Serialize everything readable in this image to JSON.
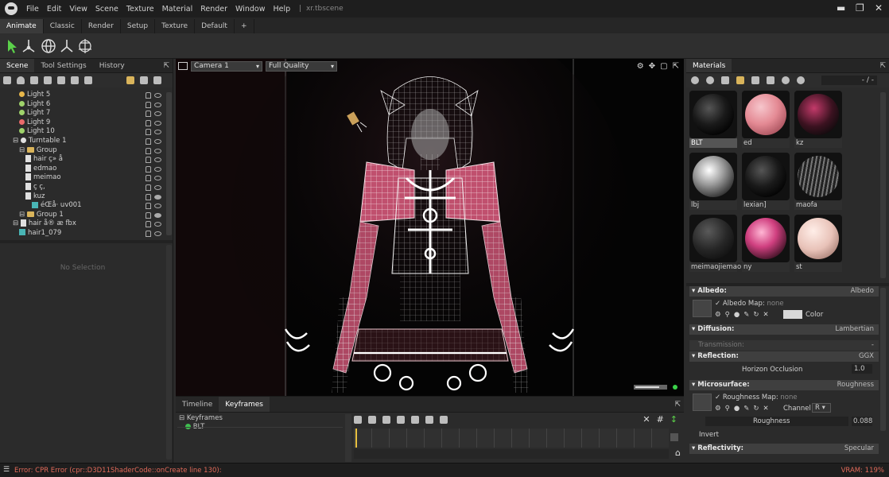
{
  "menubar": {
    "items": [
      "File",
      "Edit",
      "View",
      "Scene",
      "Texture",
      "Material",
      "Render",
      "Window",
      "Help"
    ],
    "filename": "xr.tbscene"
  },
  "modes": [
    "Animate",
    "Classic",
    "Render",
    "Setup",
    "Texture",
    "Default",
    "+"
  ],
  "left_tabs": [
    "Scene",
    "Tool Settings",
    "History"
  ],
  "tree": [
    {
      "indent": 2,
      "icon": "light",
      "color": "#e8b74a",
      "label": "Light 5"
    },
    {
      "indent": 2,
      "icon": "light",
      "color": "#9fd36b",
      "label": "Light 6"
    },
    {
      "indent": 2,
      "icon": "light",
      "color": "#9fd36b",
      "label": "Light 7"
    },
    {
      "indent": 2,
      "icon": "light",
      "color": "#e96a6a",
      "label": "Light 9"
    },
    {
      "indent": 2,
      "icon": "light",
      "color": "#9fd36b",
      "label": "Light 10"
    },
    {
      "indent": 1,
      "icon": "turntable",
      "color": "#e0e0e0",
      "label": "Turntable 1"
    },
    {
      "indent": 2,
      "icon": "folder",
      "label": "Group"
    },
    {
      "indent": 3,
      "icon": "doc",
      "label": "hair ç» å"
    },
    {
      "indent": 3,
      "icon": "doc",
      "label": "edmao"
    },
    {
      "indent": 3,
      "icon": "doc",
      "label": "meimao"
    },
    {
      "indent": 3,
      "icon": "doc",
      "label": "ç    ç,"
    },
    {
      "indent": 3,
      "icon": "doc",
      "label": "kuz"
    },
    {
      "indent": 4,
      "icon": "cube",
      "label": "éŒå·    uv001"
    },
    {
      "indent": 2,
      "icon": "folder",
      "label": "Group 1"
    },
    {
      "indent": 1,
      "icon": "doc",
      "label": "hair å®  æ    fbx"
    },
    {
      "indent": 2,
      "icon": "cube",
      "label": "hair1_079"
    }
  ],
  "no_selection": "No Selection",
  "viewport": {
    "camera": "Camera 1",
    "quality": "Full Quality"
  },
  "timeline": {
    "tabs": [
      "Timeline",
      "Keyframes"
    ],
    "tracks": [
      "Keyframes",
      "BLT"
    ]
  },
  "materials": {
    "tab": "Materials",
    "page": "- / -",
    "swatches": [
      {
        "label": "BLT",
        "style": "dark-glitter",
        "selected": true
      },
      {
        "label": "ed",
        "style": "pink-solid"
      },
      {
        "label": "kz",
        "style": "dark-pink"
      },
      {
        "label": "lbj",
        "style": "chrome"
      },
      {
        "label": "lexian]",
        "style": "dark-glitter"
      },
      {
        "label": "maofa",
        "style": "dark-stripes"
      },
      {
        "label": "meimaojiemao",
        "style": "matte-dark"
      },
      {
        "label": "ny",
        "style": "pink-pattern"
      },
      {
        "label": "st",
        "style": "skin"
      }
    ]
  },
  "properties": {
    "albedo": {
      "title": "Albedo:",
      "value": "Albedo",
      "map_label": "Albedo Map:",
      "map_value": "none",
      "color_label": "Color"
    },
    "diffusion": {
      "title": "Diffusion:",
      "value": "Lambertian"
    },
    "transmission": {
      "title": "Transmission:",
      "value": "-"
    },
    "reflection": {
      "title": "Reflection:",
      "value": "GGX",
      "prop": "Horizon Occlusion",
      "prop_value": "1.0"
    },
    "microsurface": {
      "title": "Microsurface:",
      "value": "Roughness",
      "map_label": "Roughness Map:",
      "map_value": "none",
      "channel_label": "Channel",
      "channel_value": "R",
      "roughness_label": "Roughness",
      "roughness_value": "0.088",
      "invert_label": "Invert"
    },
    "reflectivity": {
      "title": "Reflectivity:",
      "value": "Specular"
    }
  },
  "status": {
    "error": "Error: CPR Error (cpr::D3D11ShaderCode::onCreate line 130):",
    "vram": "VRAM: 119%"
  }
}
